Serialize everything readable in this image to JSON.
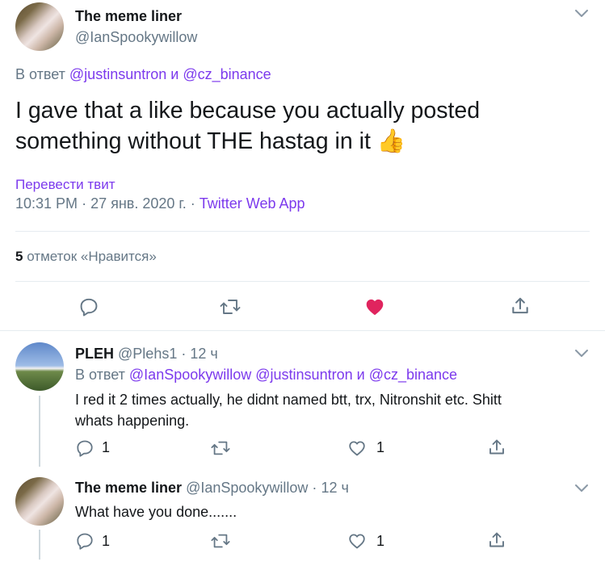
{
  "main_tweet": {
    "author_name": "The meme liner",
    "author_handle": "@IanSpookywillow",
    "reply_prefix": "В ответ",
    "reply_user_1": "@justinsuntron",
    "reply_and": "и",
    "reply_user_2": "@cz_binance",
    "text": "I gave that a like because you actually posted something without THE hastag in it",
    "emoji": "👍",
    "translate_label": "Перевести твит",
    "time": "10:31 PM",
    "sep": "·",
    "date": "27 янв. 2020 г.",
    "source": "Twitter Web App",
    "likes_count": "5",
    "likes_label": "отметок «Нравится»"
  },
  "replies": [
    {
      "author_name": "PLEH",
      "author_handle": "@Plehs1",
      "sep": "·",
      "time": "12 ч",
      "reply_prefix": "В ответ",
      "reply_user_1": "@IanSpookywillow",
      "reply_user_2": "@justinsuntron",
      "reply_and": "и",
      "reply_user_3": "@cz_binance",
      "text_line_1": "I red it 2 times actually, he didnt named btt, trx, Nitronshit etc. Shitt",
      "text_line_2": "whats happening.",
      "reply_count": "1",
      "like_count": "1"
    },
    {
      "author_name": "The meme liner",
      "author_handle": "@IanSpookywillow",
      "sep": "·",
      "time": "12 ч",
      "text": "What have you done.......",
      "reply_count": "1",
      "like_count": "1"
    }
  ],
  "colors": {
    "link": "#7c3aed",
    "like": "#e0245e",
    "muted": "#657786",
    "divider": "#e6ecf0"
  },
  "icons": [
    "chevron-down-icon",
    "reply-icon",
    "retweet-icon",
    "heart-icon",
    "share-icon",
    "thumbs-up-emoji"
  ]
}
